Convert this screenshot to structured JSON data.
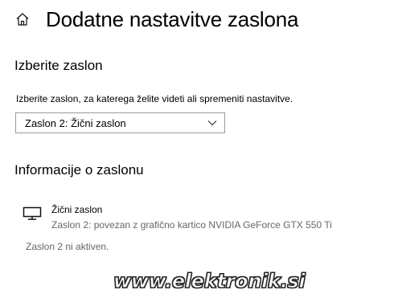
{
  "header": {
    "title": "Dodatne nastavitve zaslona",
    "home_icon": "home-icon"
  },
  "select_display": {
    "heading": "Izberite zaslon",
    "description": "Izberite zaslon, za katerega želite videti ali spremeniti nastavitve.",
    "selected_value": "Zaslon 2: Žični zaslon",
    "dropdown_icon": "chevron-down-icon"
  },
  "display_info": {
    "heading": "Informacije o zaslonu",
    "monitor_icon": "monitor-icon",
    "display_name": "Žični zaslon",
    "display_detail": "Zaslon 2: povezan z grafično kartico NVIDIA GeForce GTX 550 Ti",
    "status": "Zaslon 2 ni aktiven."
  },
  "watermark": {
    "text": "www.elektronik.si"
  }
}
